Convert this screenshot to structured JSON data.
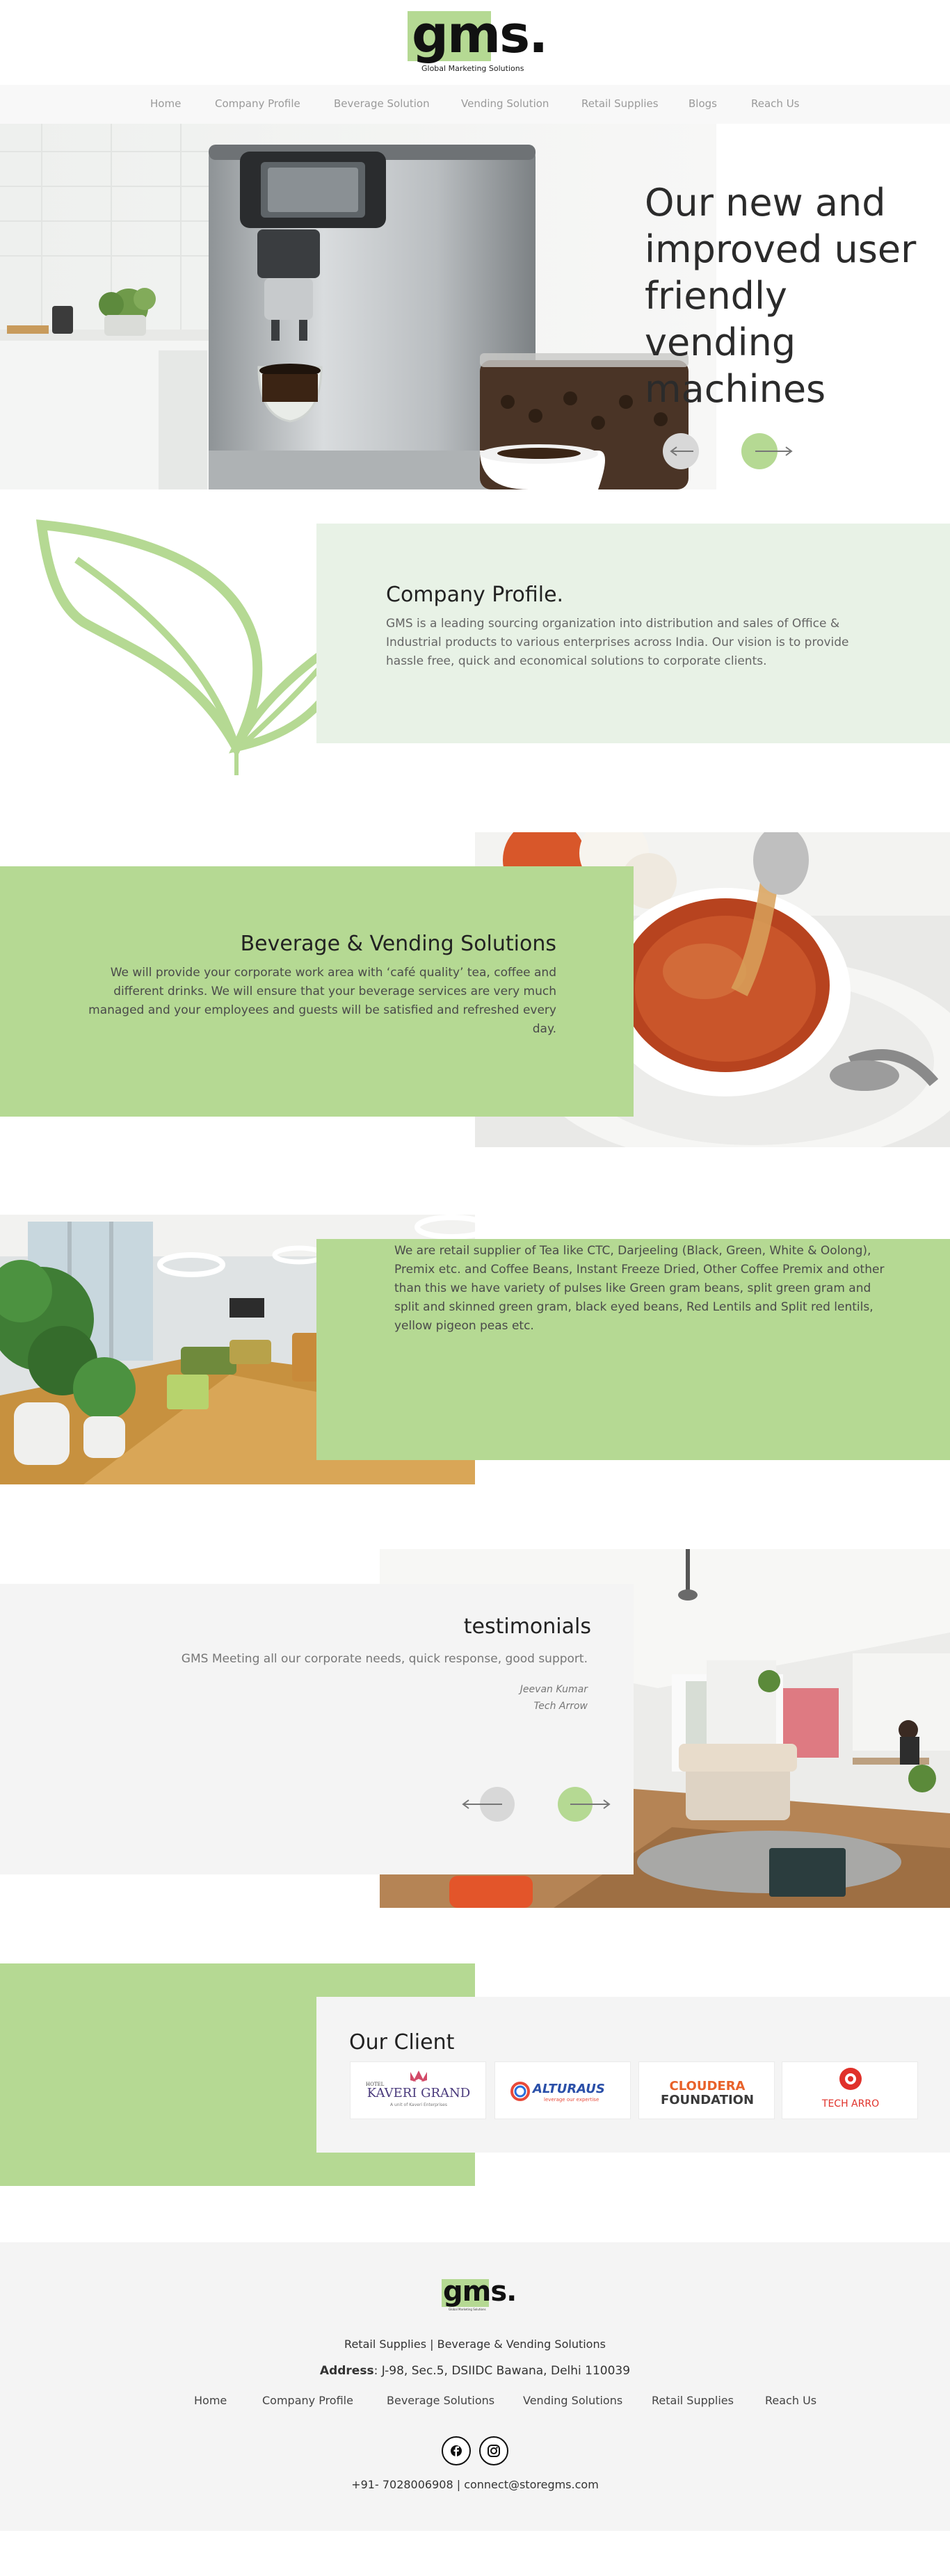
{
  "brand": {
    "logo_text": "gms.",
    "tagline": "Global Marketing Solutions",
    "accent": "#b5d993",
    "light_accent": "#e8f2e6"
  },
  "nav": {
    "items": [
      "Home",
      "Company Profile",
      "Beverage Solution",
      "Vending Solution",
      "Retail Supplies",
      "Blogs",
      "Reach Us"
    ]
  },
  "hero": {
    "title": "Our new and improved user friendly vending machines",
    "prev_icon": "arrow-left-icon",
    "next_icon": "arrow-right-icon"
  },
  "company_profile": {
    "title": "Company Profile.",
    "text": "GMS is a leading sourcing organization into distribution and sales of Office & Industrial products to various enterprises across India. Our vision is to provide hassle free, quick and economical solutions to corporate clients."
  },
  "beverage": {
    "title": "Beverage & Vending Solutions",
    "text": "We will provide your corporate work area with ‘café quality’ tea, coffee and different drinks. We will ensure that your beverage services are very much managed and your employees and guests will be satisfied and refreshed every day."
  },
  "retail": {
    "text": "We are retail supplier of Tea like CTC, Darjeeling (Black, Green, White & Oolong), Premix etc. and Coffee Beans, Instant Freeze Dried, Other Coffee Premix and other than this we have variety of pulses like Green gram beans, split green gram and split and skinned green gram, black eyed beans, Red Lentils and Split red lentils, yellow pigeon peas etc."
  },
  "testimonials": {
    "title": "testimonials",
    "quote": "GMS Meeting all our corporate needs, quick response, good support.",
    "name": "Jeevan Kumar",
    "company": "Tech Arrow"
  },
  "clients": {
    "title": "Our Client",
    "logos": [
      {
        "top": "HOTEL",
        "name": "KAVERI GRAND",
        "sub": "A unit of Kaveri Enterprises"
      },
      {
        "name": "ALTURAUS",
        "sub": "leverage our expertise"
      },
      {
        "name": "CLOUDERA",
        "sub": "FOUNDATION"
      },
      {
        "name": "TECH ARRO"
      }
    ]
  },
  "footer": {
    "logo_text": "gms.",
    "tagline": "Global Marketing Solutions",
    "services": "Retail Supplies | Beverage & Vending Solutions",
    "address_label": "Address",
    "address": ": J-98, Sec.5, DSIIDC Bawana, Delhi 110039",
    "nav": [
      "Home",
      "Company Profile",
      "Beverage Solutions",
      "Vending Solutions",
      "Retail Supplies",
      "Reach Us"
    ],
    "social": [
      "facebook-icon",
      "instagram-icon"
    ],
    "contact": "+91- 7028006908 | connect@storegms.com"
  }
}
